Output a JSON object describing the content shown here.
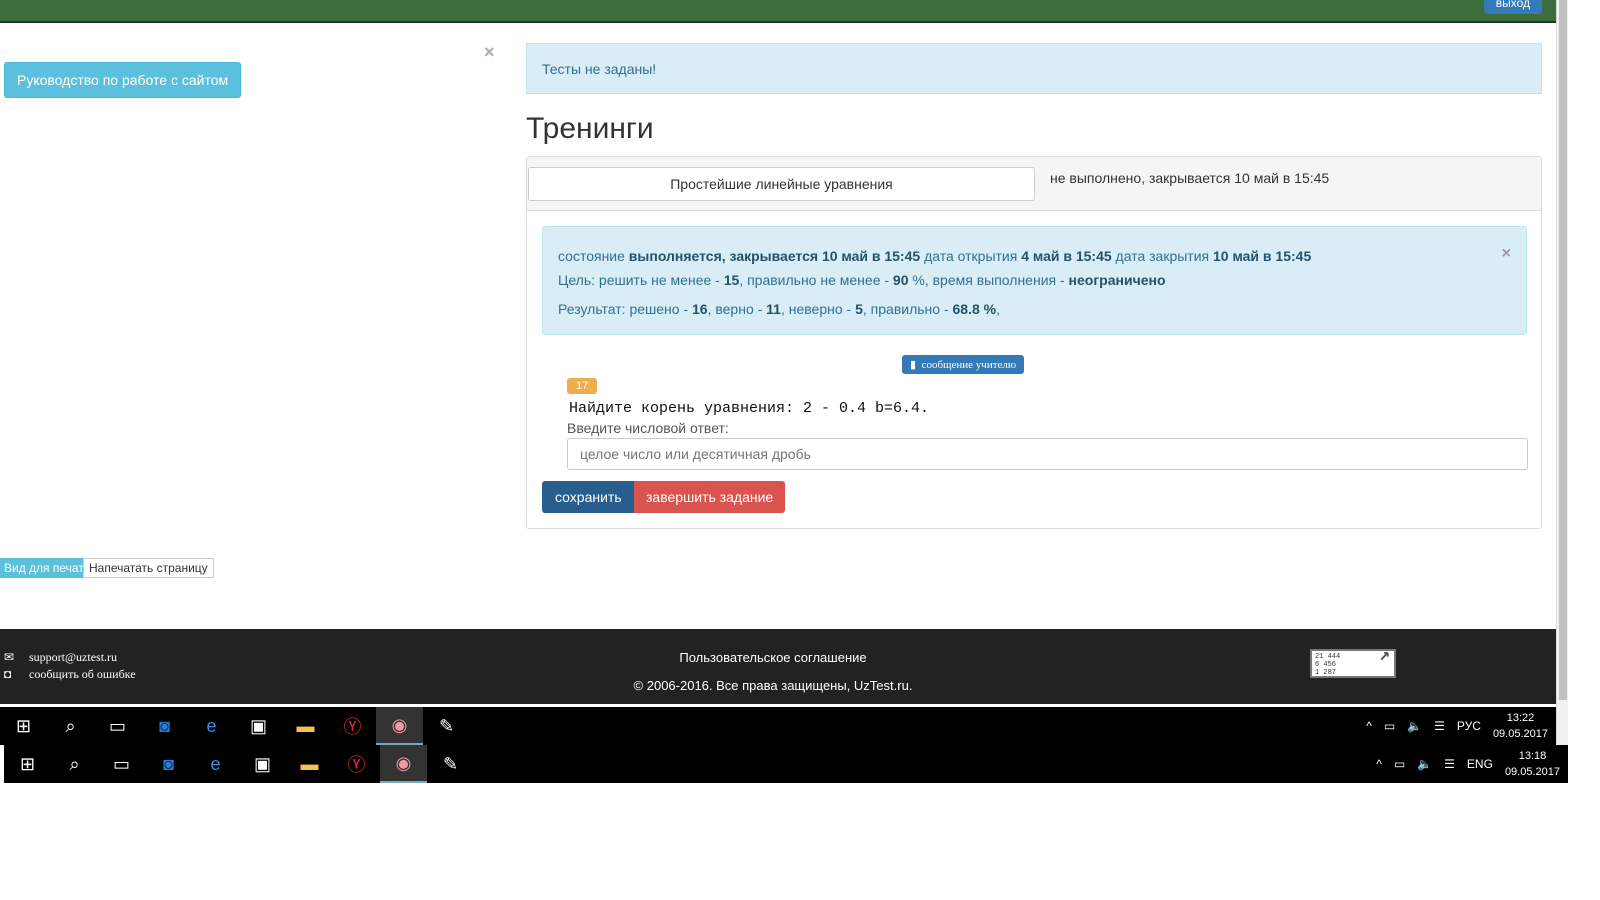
{
  "header": {
    "exit_label": "выход"
  },
  "sidebar": {
    "guide_button": "Руководство по работе с сайтом",
    "close": "×"
  },
  "alert": {
    "text": "Тесты не заданы!"
  },
  "page_title": "Тренинги",
  "training": {
    "title": "Простейшие линейные уравнения",
    "status": "не выполнено, закрывается 10 май в 15:45",
    "info": {
      "state_label": "состояние",
      "state": "выполняется, закрывается 10 май в 15:45",
      "open_label": "дата открытия",
      "open": "4 май в 15:45",
      "close_label": "дата закрытия",
      "close": "10 май в 15:45",
      "goal_label": "Цель: решить не менее -",
      "goal_solve": "15",
      "goal_correct_label": ", правильно не менее -",
      "goal_correct": "90",
      "goal_time_label": "%, время выполнения -",
      "goal_time": "неограничено",
      "result_label": "Результат: решено -",
      "solved": "16",
      "right_label": ", верно -",
      "right": "11",
      "wrong_label": ", неверно -",
      "wrong": "5",
      "pct_label": ", правильно -",
      "pct": "68.8 %",
      "close_icon": "×"
    },
    "message_button": "сообщение   учителю",
    "task_number": "17",
    "task_text": "Найдите корень уравнения: 2 - 0.4 b=6.4.",
    "answer_label": "Введите числовой ответ:",
    "answer_placeholder": "целое число или десятичная дробь",
    "save": "сохранить",
    "finish": "завершить задание"
  },
  "print": {
    "view": "Вид для печати",
    "print": "Напечатать страницу"
  },
  "footer": {
    "email": "support@uztest.ru",
    "report": "сообщить   об   ошибке",
    "agreement": "Пользовательское соглашение",
    "copyright": "© 2006-2016. Все права защищены, UzTest.ru.",
    "counter": [
      "21 444",
      "6 456",
      "1 287"
    ]
  },
  "taskbar1": {
    "lang": "РУС",
    "time": "13:22",
    "date": "09.05.2017"
  },
  "taskbar2": {
    "lang": "ENG",
    "time": "13:18",
    "date": "09.05.2017"
  }
}
